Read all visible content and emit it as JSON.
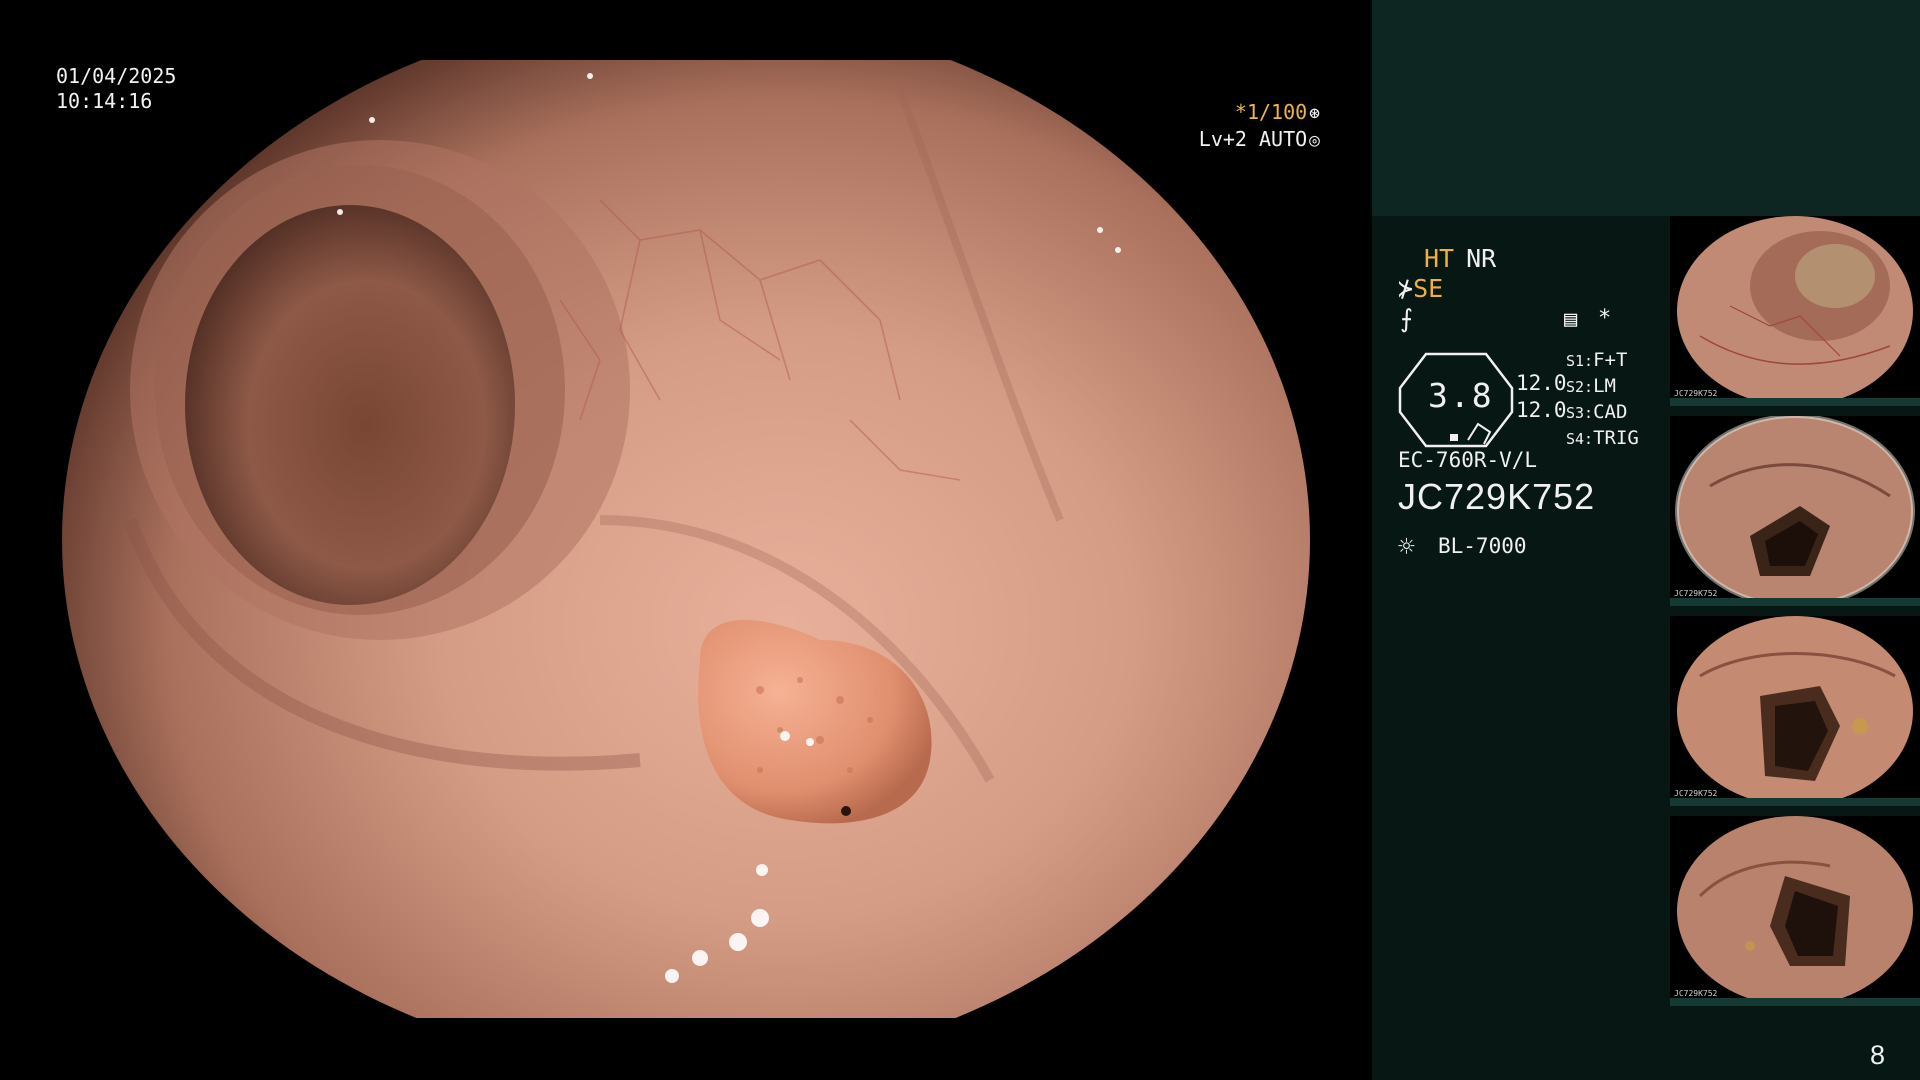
{
  "overlay": {
    "date": "01/04/2025",
    "time": "10:14:16",
    "shutter_speed": "*1/100",
    "shutter_glyph": "⊛",
    "level_mode": "Lv+2 AUTO",
    "level_glyph": "◎"
  },
  "panel": {
    "ht_label": "HT",
    "nr_label": "NR",
    "se_glyph": "⊁",
    "se_label": "SE",
    "f_glyph": "⨍",
    "menu_glyph": "▤",
    "star_glyph": "*",
    "zoom_value": "3.8",
    "values": [
      "12.0",
      "12.0"
    ],
    "scope_buttons": [
      {
        "key": "S1:",
        "value": "F+T"
      },
      {
        "key": "S2:",
        "value": "LM"
      },
      {
        "key": "S3:",
        "value": "CAD"
      },
      {
        "key": "S4:",
        "value": "TRIG"
      }
    ],
    "model": "EC-760R-V/L",
    "serial": "JC729K752",
    "light_icon": "☼",
    "light_source": "BL-7000",
    "page_number": "8"
  },
  "thumbnails": [
    {
      "caption": "JC729K752"
    },
    {
      "caption": "JC729K752"
    },
    {
      "caption": "JC729K752"
    },
    {
      "caption": "JC729K752"
    }
  ],
  "colors": {
    "panel_bg": "#071714",
    "panel_top": "#0d2622",
    "amber": "#f0b040",
    "mucosa": "#c98f78"
  }
}
